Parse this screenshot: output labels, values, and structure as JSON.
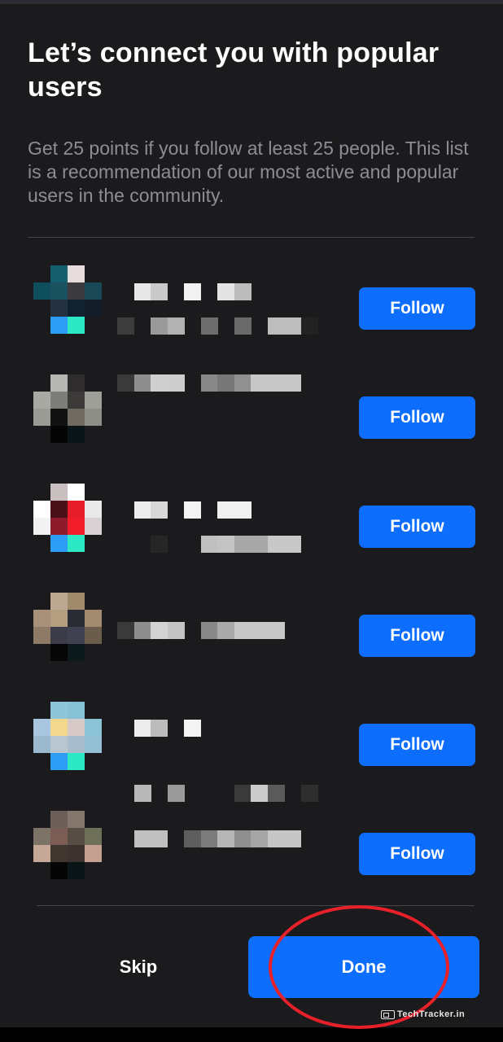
{
  "header": {
    "title": "Let’s connect you with popular users",
    "subtitle": "Get 25 points if you follow at least 25 people. This list is a recommendation of our most active and popular users in the community."
  },
  "users": [
    {
      "name": "",
      "handle": "",
      "follow_label": "Follow",
      "avatar_blurred": true
    },
    {
      "name": "",
      "handle": "",
      "follow_label": "Follow",
      "avatar_blurred": true
    },
    {
      "name": "",
      "handle": "",
      "follow_label": "Follow",
      "avatar_blurred": true
    },
    {
      "name": "",
      "handle": "",
      "follow_label": "Follow",
      "avatar_blurred": true
    },
    {
      "name": "",
      "handle": "",
      "follow_label": "Follow",
      "avatar_blurred": true
    },
    {
      "name": "",
      "handle": "",
      "follow_label": "Follow",
      "avatar_blurred": true
    }
  ],
  "footer": {
    "skip_label": "Skip",
    "done_label": "Done"
  },
  "annotation": {
    "shape": "circle",
    "color": "#e8202a",
    "target": "done-button"
  },
  "watermark": {
    "text": "TechTracker.in"
  },
  "colors": {
    "background": "#1b1b1d",
    "accent": "#0d6efd",
    "subtitle_text": "#8d8d92",
    "annotation": "#e8202a"
  },
  "icons": {
    "watermark": "browser-window-icon"
  }
}
